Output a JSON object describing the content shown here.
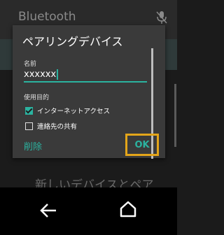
{
  "background": {
    "title": "Bluetooth",
    "bottom_text": "新しいデバイスとペア"
  },
  "dialog": {
    "title": "ペアリングデバイス",
    "name_label": "名前",
    "name_value": "xxxxxx",
    "purpose_label": "使用目的",
    "options": [
      {
        "label": "インターネットアクセス",
        "checked": true
      },
      {
        "label": "連絡先の共有",
        "checked": false
      }
    ],
    "delete_label": "削除",
    "ok_label": "OK"
  },
  "colors": {
    "accent": "#2bb3a0",
    "highlight": "#e3a51a",
    "dialog_bg": "#3a3a3a"
  },
  "icons": [
    "mic-off-icon",
    "back-icon",
    "home-icon"
  ]
}
